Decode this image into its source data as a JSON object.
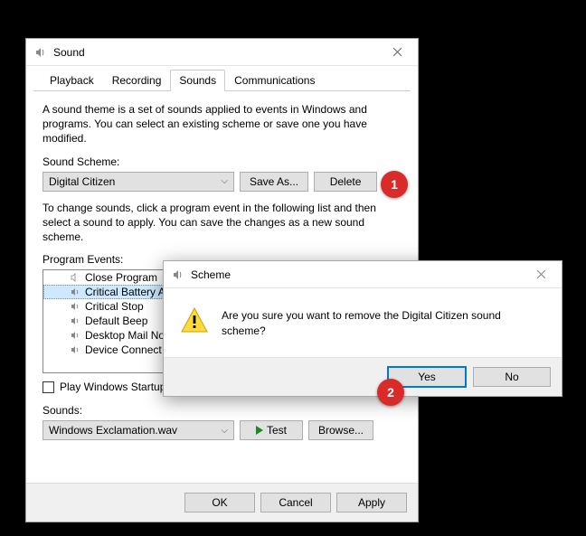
{
  "main": {
    "title": "Sound",
    "tabs": [
      "Playback",
      "Recording",
      "Sounds",
      "Communications"
    ],
    "active_tab_index": 2,
    "desc1": "A sound theme is a set of sounds applied to events in Windows and programs.  You can select an existing scheme or save one you have modified.",
    "scheme_label": "Sound Scheme:",
    "scheme_value": "Digital Citizen",
    "save_as": "Save As...",
    "delete": "Delete",
    "desc2": "To change sounds, click a program event in the following list and then select a sound to apply.  You can save the changes as a new sound scheme.",
    "events_label": "Program Events:",
    "events": [
      {
        "label": "Close Program",
        "sound": false
      },
      {
        "label": "Critical Battery Alarm",
        "sound": true,
        "selected": true
      },
      {
        "label": "Critical Stop",
        "sound": true
      },
      {
        "label": "Default Beep",
        "sound": true
      },
      {
        "label": "Desktop Mail Notification",
        "sound": true
      },
      {
        "label": "Device Connect",
        "sound": true
      }
    ],
    "startup_checkbox": "Play Windows Startup sound",
    "sounds_label": "Sounds:",
    "sounds_value": "Windows Exclamation.wav",
    "test": "Test",
    "browse": "Browse...",
    "ok": "OK",
    "cancel": "Cancel",
    "apply": "Apply"
  },
  "modal": {
    "title": "Scheme",
    "message": "Are you sure you want to remove the Digital Citizen sound scheme?",
    "yes": "Yes",
    "no": "No"
  },
  "annotations": {
    "a1": "1",
    "a2": "2"
  }
}
